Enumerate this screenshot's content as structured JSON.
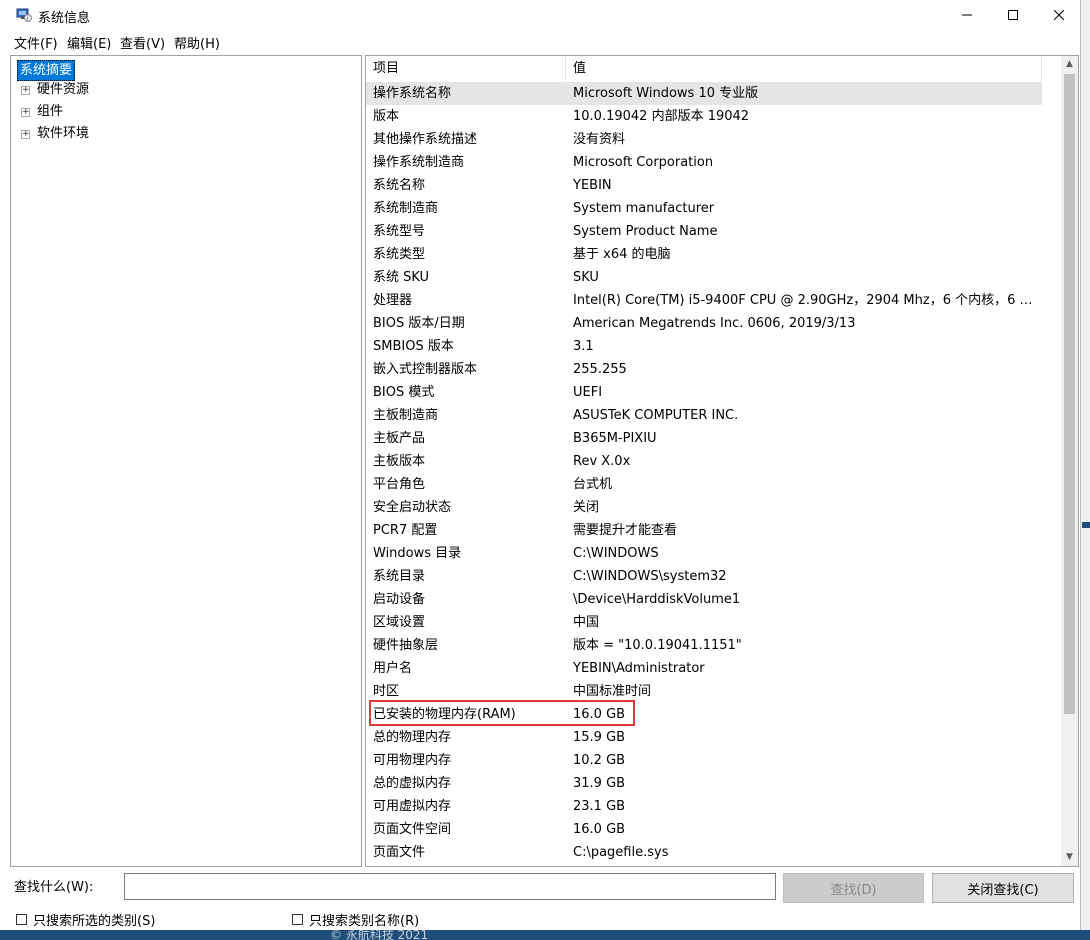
{
  "window": {
    "title": "系统信息",
    "controls": {
      "minimize": "—",
      "maximize": "☐",
      "close": "✕"
    }
  },
  "menu": [
    "文件(F)",
    "编辑(E)",
    "查看(V)",
    "帮助(H)"
  ],
  "tree": {
    "selected": "系统摘要",
    "children": [
      "硬件资源",
      "组件",
      "软件环境"
    ]
  },
  "table": {
    "headers": [
      "项目",
      "值"
    ],
    "rows": [
      {
        "item": "操作系统名称",
        "value": "Microsoft Windows 10 专业版"
      },
      {
        "item": "版本",
        "value": "10.0.19042 内部版本 19042"
      },
      {
        "item": "其他操作系统描述",
        "value": "没有资料"
      },
      {
        "item": "操作系统制造商",
        "value": "Microsoft Corporation"
      },
      {
        "item": "系统名称",
        "value": "YEBIN"
      },
      {
        "item": "系统制造商",
        "value": "System manufacturer"
      },
      {
        "item": "系统型号",
        "value": "System Product Name"
      },
      {
        "item": "系统类型",
        "value": "基于 x64 的电脑"
      },
      {
        "item": "系统 SKU",
        "value": "SKU"
      },
      {
        "item": "处理器",
        "value": "Intel(R) Core(TM) i5-9400F CPU @ 2.90GHz，2904 Mhz，6 个内核，6 个..."
      },
      {
        "item": "BIOS 版本/日期",
        "value": "American Megatrends Inc. 0606, 2019/3/13"
      },
      {
        "item": "SMBIOS 版本",
        "value": "3.1"
      },
      {
        "item": "嵌入式控制器版本",
        "value": "255.255"
      },
      {
        "item": "BIOS 模式",
        "value": "UEFI"
      },
      {
        "item": "主板制造商",
        "value": "ASUSTeK COMPUTER INC."
      },
      {
        "item": "主板产品",
        "value": "B365M-PIXIU"
      },
      {
        "item": "主板版本",
        "value": "Rev X.0x"
      },
      {
        "item": "平台角色",
        "value": "台式机"
      },
      {
        "item": "安全启动状态",
        "value": "关闭"
      },
      {
        "item": "PCR7 配置",
        "value": "需要提升才能查看"
      },
      {
        "item": "Windows 目录",
        "value": "C:\\WINDOWS"
      },
      {
        "item": "系统目录",
        "value": "C:\\WINDOWS\\system32"
      },
      {
        "item": "启动设备",
        "value": "\\Device\\HarddiskVolume1"
      },
      {
        "item": "区域设置",
        "value": "中国"
      },
      {
        "item": "硬件抽象层",
        "value": "版本 = \"10.0.19041.1151\""
      },
      {
        "item": "用户名",
        "value": "YEBIN\\Administrator"
      },
      {
        "item": "时区",
        "value": "中国标准时间"
      },
      {
        "item": "已安装的物理内存(RAM)",
        "value": "16.0 GB"
      },
      {
        "item": "总的物理内存",
        "value": "15.9 GB"
      },
      {
        "item": "可用物理内存",
        "value": "10.2 GB"
      },
      {
        "item": "总的虚拟内存",
        "value": "31.9 GB"
      },
      {
        "item": "可用虚拟内存",
        "value": "23.1 GB"
      },
      {
        "item": "页面文件空间",
        "value": "16.0 GB"
      },
      {
        "item": "页面文件",
        "value": "C:\\pagefile.sys"
      }
    ]
  },
  "find": {
    "label": "查找什么(W):",
    "input_value": "",
    "find_button": "查找(D)",
    "close_find_button": "关闭查找(C)",
    "checkbox_selected_category": "只搜索所选的类别(S)",
    "checkbox_category_names": "只搜索类别名称(R)"
  },
  "footer_watermark": "© 永航科技 2021",
  "colors": {
    "selection": "#0078d7",
    "highlight_box": "#e03a3a",
    "first_row": "#e5e5e5"
  }
}
